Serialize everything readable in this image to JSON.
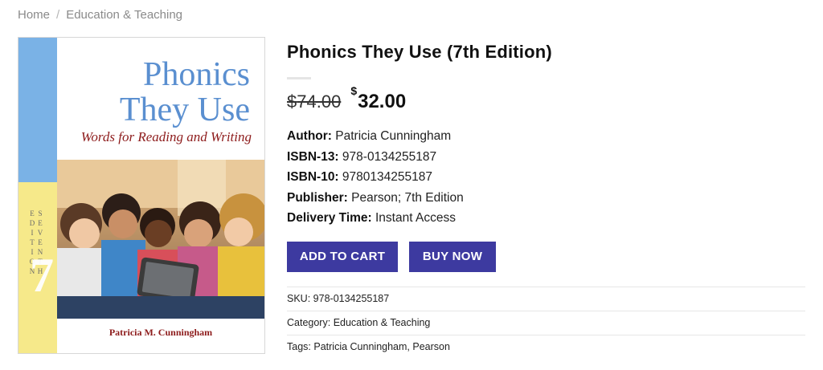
{
  "breadcrumb": {
    "home": "Home",
    "separator": "/",
    "current": "Education & Teaching"
  },
  "cover": {
    "title_line1": "Phonics",
    "title_line2": "They Use",
    "subtitle": "Words for Reading and Writing",
    "spine_text": "SEVENTH EDITION",
    "spine_number": "7",
    "author": "Patricia M. Cunningham",
    "colors": {
      "spine_blue": "#7ab2e6",
      "spine_yellow": "#f6e98a",
      "title": "#5a8fd0",
      "subtitle": "#8d1b1b"
    }
  },
  "product": {
    "title": "Phonics They Use (7th Edition)",
    "currency": "$",
    "old_price": "74.00",
    "new_price": "32.00",
    "details": [
      {
        "label": "Author:",
        "value": "Patricia Cunningham"
      },
      {
        "label": "ISBN-13:",
        "value": "978-0134255187"
      },
      {
        "label": "ISBN-10:",
        "value": "9780134255187"
      },
      {
        "label": "Publisher:",
        "value": "Pearson; 7th Edition"
      },
      {
        "label": "Delivery Time:",
        "value": "Instant Access"
      }
    ],
    "buttons": {
      "add_to_cart": "ADD TO CART",
      "buy_now": "BUY NOW"
    },
    "meta": {
      "sku_label": "SKU:",
      "sku": "978-0134255187",
      "category_label": "Category:",
      "category": "Education & Teaching",
      "tags_label": "Tags:",
      "tag1": "Patricia Cunningham",
      "tag_sep": ",",
      "tag2": "Pearson"
    },
    "accent_color": "#3d3aa0"
  }
}
